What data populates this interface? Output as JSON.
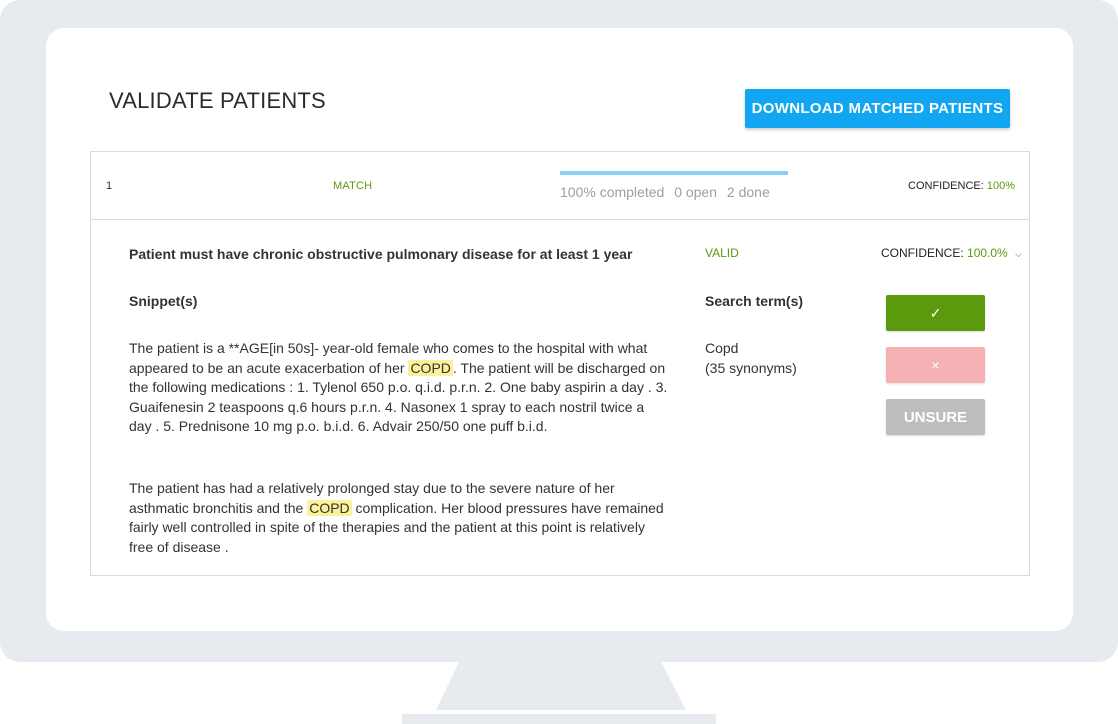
{
  "header": {
    "title": "VALIDATE PATIENTS",
    "download_label": "DOWNLOAD MATCHED PATIENTS"
  },
  "record": {
    "index": "1",
    "status": "MATCH",
    "progress": {
      "percent": 100,
      "completed_text": "100% completed",
      "open_text": "0 open",
      "done_text": "2 done"
    },
    "confidence_label": "CONFIDENCE:",
    "confidence_value": "100%"
  },
  "criterion": {
    "text": "Patient must have chronic obstructive pulmonary disease for at least 1 year",
    "status": "VALID",
    "confidence_label": "CONFIDENCE:",
    "confidence_value": "100.0%"
  },
  "columns": {
    "snippets_heading": "Snippet(s)",
    "search_heading": "Search term(s)"
  },
  "snippets": [
    {
      "before": "The patient is a **AGE[in 50s]- year-old female who comes to the hospital with what appeared to be an acute exacerbation of her ",
      "highlight": "COPD",
      "after": ". The patient will be discharged on the following medications : 1. Tylenol 650 p.o. q.i.d. p.r.n. 2. One baby aspirin a day . 3. Guaifenesin 2 teaspoons q.6 hours p.r.n. 4. Nasonex 1 spray to each nostril twice a day . 5. Prednisone 10 mg p.o. b.i.d. 6. Advair 250/50 one puff b.i.d."
    },
    {
      "before": "The patient has had a relatively prolonged stay due to the severe nature of her asthmatic bronchitis and the ",
      "highlight": "COPD",
      "after": " complication. Her blood pressures have remained fairly well controlled in spite of the therapies and the patient at this point is relatively free of disease ."
    }
  ],
  "search_terms": {
    "term": "Copd",
    "synonyms": "(35 synonyms)"
  },
  "actions": {
    "accept_symbol": "✓",
    "reject_symbol": "×",
    "unsure_label": "UNSURE"
  },
  "colors": {
    "primary_button": "#12a6f2",
    "accept": "#5a9a0c",
    "reject": "#f6b1b4",
    "unsure": "#bdbdbd",
    "status_green": "#5a9a12",
    "highlight": "#fbf19a"
  }
}
